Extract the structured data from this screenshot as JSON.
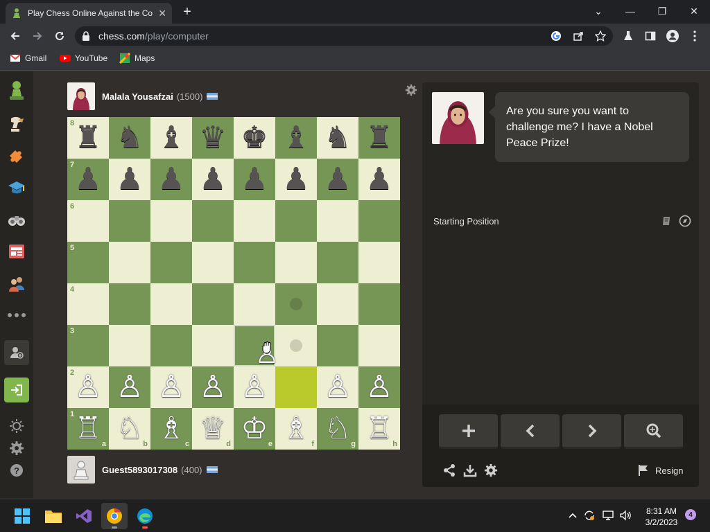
{
  "browser": {
    "tab_title": "Play Chess Online Against the Co",
    "tab_close": "✕",
    "new_tab": "+",
    "url_host": "chess.com",
    "url_path": "/play/computer",
    "window_controls": {
      "minimize": "—",
      "maximize": "❐",
      "close": "✕",
      "tab_search": "⌄"
    }
  },
  "bookmarks": [
    {
      "label": "Gmail",
      "icon": "gmail-icon"
    },
    {
      "label": "YouTube",
      "icon": "youtube-icon"
    },
    {
      "label": "Maps",
      "icon": "maps-icon"
    }
  ],
  "sidebar": {
    "items": [
      "pawn-logo-icon",
      "play-icon",
      "puzzles-icon",
      "learn-icon",
      "watch-icon",
      "news-icon",
      "social-icon",
      "more-icon",
      "add-friend-icon",
      "login-icon",
      "theme-icon",
      "settings-icon",
      "help-icon"
    ]
  },
  "opponent": {
    "name": "Malala Yousafzai",
    "rating": "(1500)"
  },
  "player": {
    "name": "Guest5893017308",
    "rating": "(400)"
  },
  "board": {
    "ranks": [
      "8",
      "7",
      "6",
      "5",
      "4",
      "3",
      "2",
      "1"
    ],
    "files": [
      "a",
      "b",
      "c",
      "d",
      "e",
      "f",
      "g",
      "h"
    ],
    "colors": {
      "light": "#eeeed2",
      "dark": "#769656",
      "highlight": "#baca2b"
    },
    "pieces": [
      {
        "sq": "a8",
        "glyph": "♜",
        "color": "b"
      },
      {
        "sq": "b8",
        "glyph": "♞",
        "color": "b"
      },
      {
        "sq": "c8",
        "glyph": "♝",
        "color": "b"
      },
      {
        "sq": "d8",
        "glyph": "♛",
        "color": "b"
      },
      {
        "sq": "e8",
        "glyph": "♚",
        "color": "b"
      },
      {
        "sq": "f8",
        "glyph": "♝",
        "color": "b"
      },
      {
        "sq": "g8",
        "glyph": "♞",
        "color": "b"
      },
      {
        "sq": "h8",
        "glyph": "♜",
        "color": "b"
      },
      {
        "sq": "a7",
        "glyph": "♟",
        "color": "b"
      },
      {
        "sq": "b7",
        "glyph": "♟",
        "color": "b"
      },
      {
        "sq": "c7",
        "glyph": "♟",
        "color": "b"
      },
      {
        "sq": "d7",
        "glyph": "♟",
        "color": "b"
      },
      {
        "sq": "e7",
        "glyph": "♟",
        "color": "b"
      },
      {
        "sq": "f7",
        "glyph": "♟",
        "color": "b"
      },
      {
        "sq": "g7",
        "glyph": "♟",
        "color": "b"
      },
      {
        "sq": "h7",
        "glyph": "♟",
        "color": "b"
      },
      {
        "sq": "a2",
        "glyph": "♙",
        "color": "w"
      },
      {
        "sq": "b2",
        "glyph": "♙",
        "color": "w"
      },
      {
        "sq": "c2",
        "glyph": "♙",
        "color": "w"
      },
      {
        "sq": "d2",
        "glyph": "♙",
        "color": "w"
      },
      {
        "sq": "e2",
        "glyph": "♙",
        "color": "w"
      },
      {
        "sq": "g2",
        "glyph": "♙",
        "color": "w"
      },
      {
        "sq": "h2",
        "glyph": "♙",
        "color": "w"
      },
      {
        "sq": "a1",
        "glyph": "♖",
        "color": "w"
      },
      {
        "sq": "b1",
        "glyph": "♘",
        "color": "w"
      },
      {
        "sq": "c1",
        "glyph": "♗",
        "color": "w"
      },
      {
        "sq": "d1",
        "glyph": "♕",
        "color": "w"
      },
      {
        "sq": "e1",
        "glyph": "♔",
        "color": "w"
      },
      {
        "sq": "f1",
        "glyph": "♗",
        "color": "w"
      },
      {
        "sq": "g1",
        "glyph": "♘",
        "color": "w"
      },
      {
        "sq": "h1",
        "glyph": "♖",
        "color": "w"
      }
    ],
    "dragging_piece": {
      "glyph": "♙",
      "color": "w",
      "over": "e3"
    },
    "highlight_square": "f2",
    "hover_square": "e3",
    "legal_move_dots": [
      "f3",
      "f4"
    ]
  },
  "coach": {
    "message": "Are you sure you want to challenge me? I have a Nobel Peace Prize!"
  },
  "opening": {
    "label": "Starting Position"
  },
  "controls": {
    "buttons": [
      "new-game-icon",
      "previous-move-icon",
      "next-move-icon",
      "analysis-icon"
    ],
    "resign_label": "Resign"
  },
  "taskbar": {
    "time": "8:31 AM",
    "date": "3/2/2023",
    "notifications": "4",
    "apps": [
      "windows-start-icon",
      "file-explorer-icon",
      "visual-studio-icon",
      "chrome-icon",
      "edge-icon",
      "media-app-icon"
    ]
  }
}
